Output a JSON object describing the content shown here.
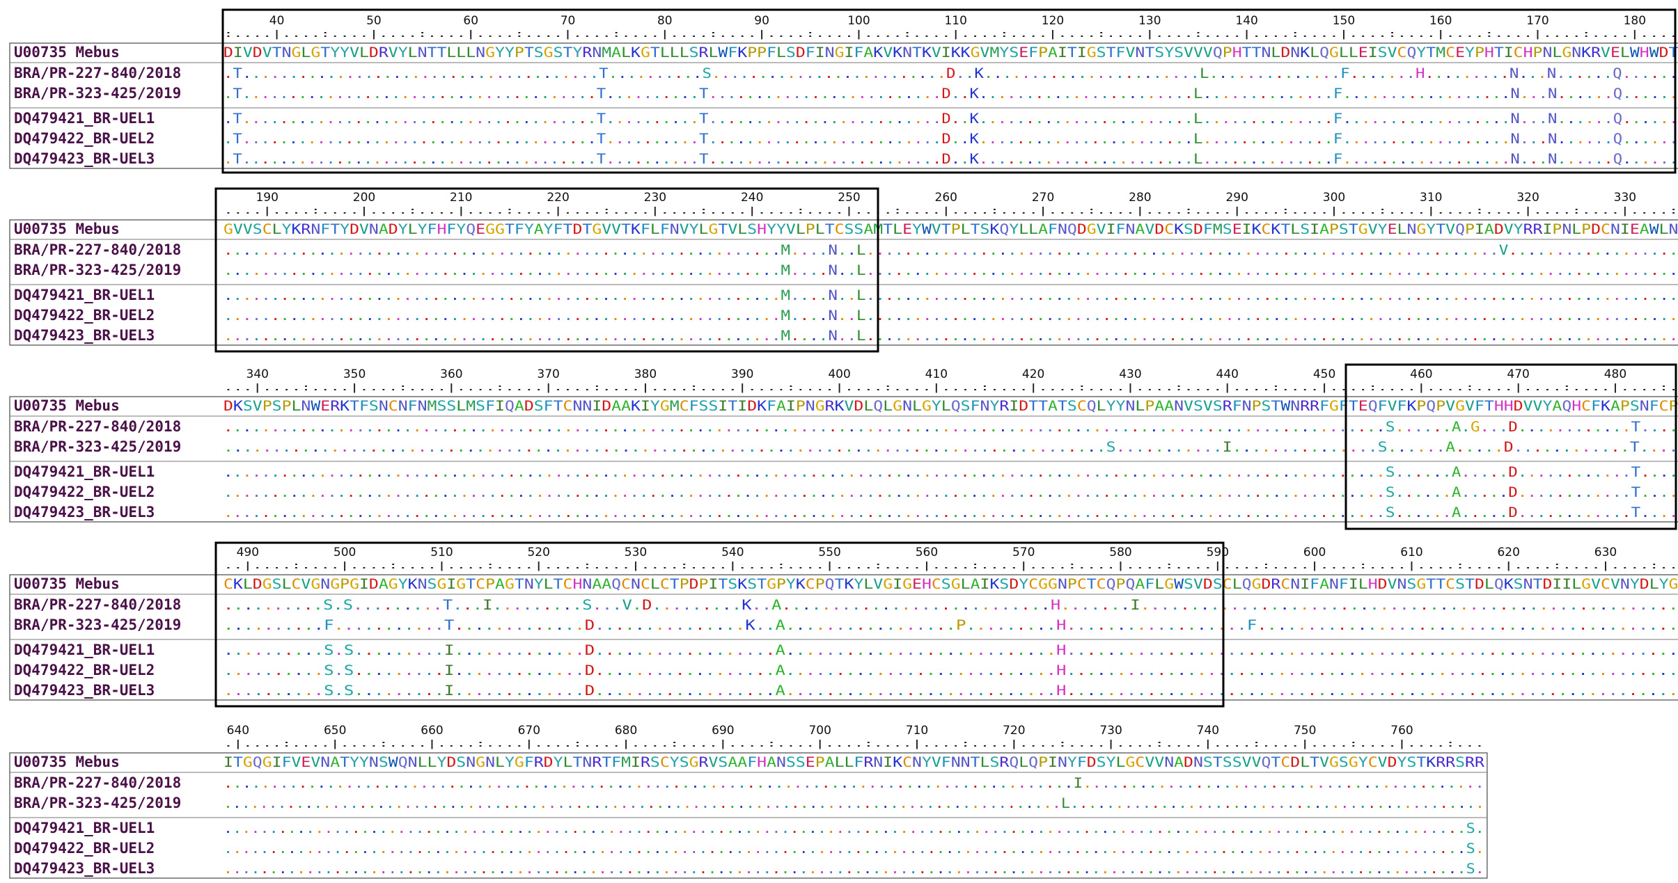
{
  "alignment": {
    "sequence_names": [
      "U00735 Mebus",
      "BRA/PR-227-840/2018",
      "BRA/PR-323-425/2019",
      "DQ479421_BR-UEL1",
      "DQ479422_BR-UEL2",
      "DQ479423_BR-UEL3"
    ],
    "blocks": [
      {
        "start": 35,
        "ticks": [
          "40",
          "50",
          "60",
          "70",
          "80",
          "90",
          "100",
          "110",
          "120",
          "130",
          "140",
          "150",
          "160",
          "170",
          "180"
        ],
        "rows": [
          "DIVDVTNGLGTYYVLDRVYLNTTLLLNGYYPTSGSTYRNMALKGTLLLSRLWFKPPFLSDFINGIFAKVKNTKVIKKGVMYSEFPAITIGSTFVNTSYSVVVQPHTTNLDNKLQGLLEISVCQYTMCEYPHTICHPNLGNKRVELWHWDT",
          ".T......................................T..........S.........................D..K.......................L..............F.......H.........N...N......Q......",
          ".T......................................T..........T.........................D..K.......................L..............F..................N...N......Q......",
          ".T......................................T..........T.........................D..K.......................L..............F..................N...N......Q......",
          ".T......................................T..........T.........................D..K.......................L..............F..................N...N......Q......",
          ".T......................................T..........T.........................D..K.......................L..............F..................N...N......Q......"
        ],
        "box": true
      },
      {
        "start": 186,
        "ticks": [
          "190",
          "200",
          "210",
          "220",
          "230",
          "240",
          "250",
          "260",
          "270",
          "280",
          "290",
          "300",
          "310",
          "320",
          "330"
        ],
        "rows": [
          "GVVSCLYKRNFTYDVNADYLYFHFYQEGGTFYAYFTDTGVVTKFLFNVYLGTVLSHYYVLPLTCSSAMTLEYWVTPLTSKQYLLAFNQDGVIFNAVDCKSDFMSEIKCKTLSIAPSTGVYELNGYTVQPIADVYRRIPNLPDCNIEAWLN",
          "...........................................................M....N..L...................................................................V..................",
          "...........................................................M....N..L......................................................................................",
          "...........................................................M....N..L......................................................................................",
          "...........................................................M....N..L......................................................................................",
          "...........................................................M....N..L......................................................................................"
        ],
        "box": true
      },
      {
        "start": 337,
        "ticks": [
          "340",
          "350",
          "360",
          "370",
          "380",
          "390",
          "400",
          "410",
          "420",
          "430",
          "440",
          "450",
          "460",
          "470",
          "480"
        ],
        "rows": [
          "DKSVPSPLNWERKTFSNCNFNMSSLMSFIQADSFTCNNIDAAKIYGMCFSSITIDKFAIPNGRKVDLQLGNLGYLQSFNYRIDTTATSCQLYYNLPAANVSVSRFNPSTWNRRFGFTEQFVFKPQPVGVFTHHDVVYAQHCFKAPSNFCP",
          "...........................................................................................................................S......A.G...D............T....",
          "...........................................................................................S...........I...............S......A.....D............T....",
          "...........................................................................................................................S......A.....D............T....",
          "...........................................................................................................................S......A.....D............T....",
          "...........................................................................................................................S......A.....D............T...."
        ],
        "box": true
      },
      {
        "start": 488,
        "ticks": [
          "490",
          "500",
          "510",
          "520",
          "530",
          "540",
          "550",
          "560",
          "570",
          "580",
          "590",
          "600",
          "610",
          "620",
          "630"
        ],
        "rows": [
          "CKLDGSLCVGNGPGIDAGYKNSGIGTCPAGTNYLTCHNAAQCNCLCTPDPITSKSTGPYKCPQTKYLVGIGEHCSGLAIKSDYCGGNPCTCQPQAFLGWSVDSCLQGDRCNIFANFILHDVNSGTTCSTDLQKSNTDIILGVCVNYDLYG",
          "..........S.S.........T...I.........S...V.D.........K..A...........................H.......I......................................................",
          "..........F...........T.............D...............K..A.................P.........H..................F..........................................",
          "..........S.S.........I.............D..................A...........................H.............................................................",
          "..........S.S.........I.............D..................A...........................H.............................................................",
          "..........S.S.........I.............D..................A...........................H............................................................."
        ],
        "box": true
      },
      {
        "start": 639,
        "ticks": [
          "640",
          "650",
          "660",
          "670",
          "680",
          "690",
          "700",
          "710",
          "720",
          "730",
          "740",
          "750",
          "760"
        ],
        "rows": [
          "ITGQGIFVEVNATYYNSWQNLLYDSNGNLYGFRDYLTNRTFMIRSCYSGRVSAAFHANSSEPALLFRNIKCNYVFNNTLSRQLQPINYFDSYLGCVVNADNSTSSVVQTCDLTVGSGYCVDYSTKRRSRR",
          "...........................................................................................I...........................................",
          ".............................................................................................L..............................................",
          "........................................................................................................................................S.",
          "........................................................................................................................................S.",
          "........................................................................................................................................S."
        ],
        "box": false
      }
    ]
  }
}
